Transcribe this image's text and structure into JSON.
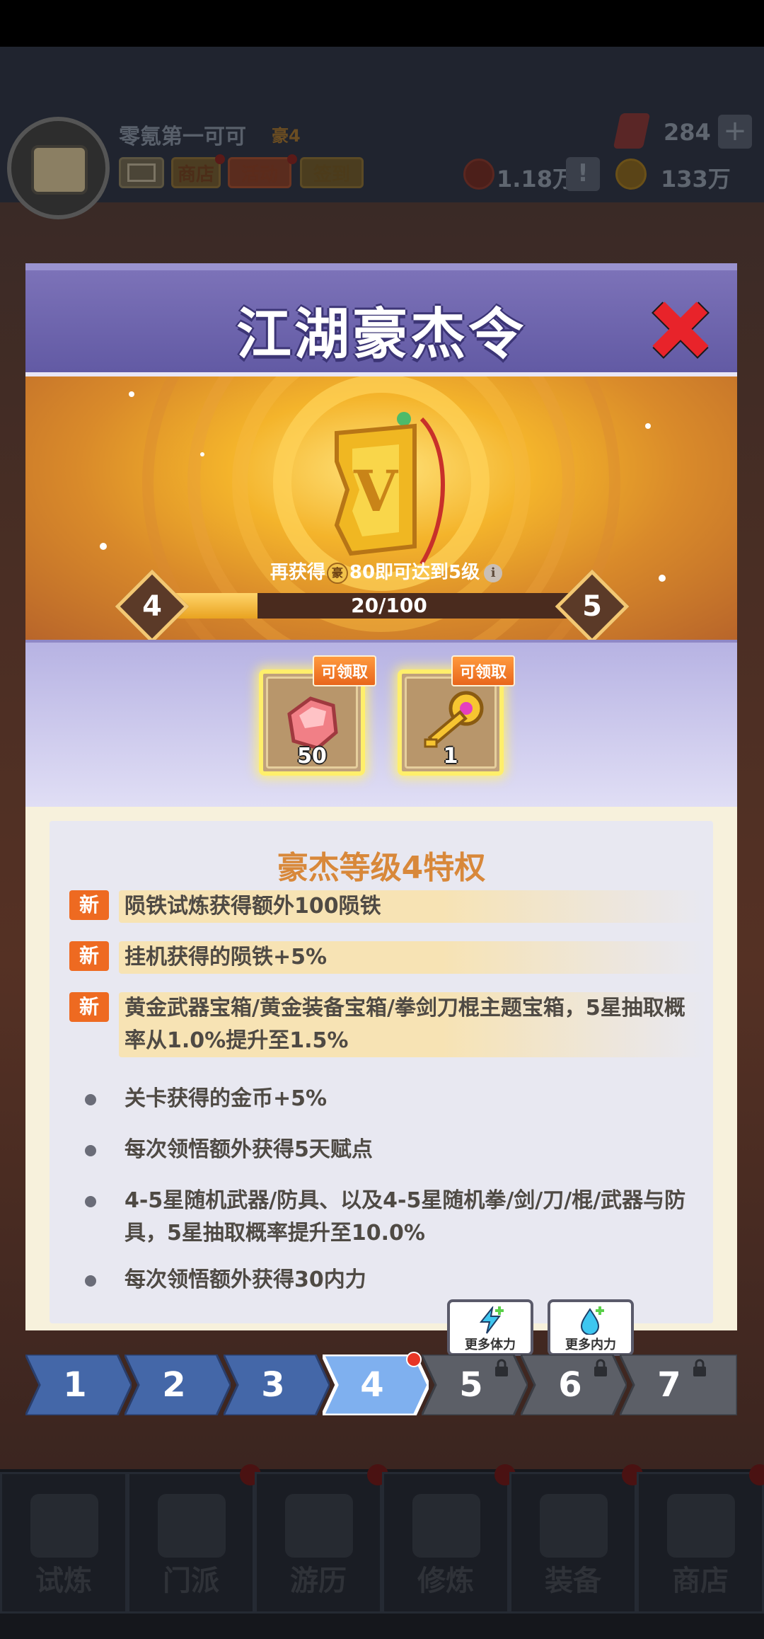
{
  "background": {
    "player_name": "零氪第一可可",
    "player_rank": "豪4",
    "buttons": {
      "shop": "商店",
      "activity": "活动",
      "sign_in": "签到"
    },
    "resources": {
      "gems": "284",
      "power": "1.18万",
      "coins": "133万"
    },
    "nav": [
      {
        "label": "试炼",
        "icon": "ninja-icon"
      },
      {
        "label": "门派",
        "icon": "temple-icon"
      },
      {
        "label": "游历",
        "icon": "mountain-icon"
      },
      {
        "label": "修炼",
        "icon": "scroll-icon"
      },
      {
        "label": "装备",
        "icon": "sword-icon"
      },
      {
        "label": "商店",
        "icon": "house-icon"
      }
    ]
  },
  "modal": {
    "title": "江湖豪杰令",
    "level_message_prefix": "再获得",
    "level_message_badge": "豪",
    "level_message_suffix": "80即可达到5级",
    "current_level": "4",
    "next_level": "5",
    "progress_text": "20/100",
    "progress_fraction": 0.2,
    "rewards": [
      {
        "tag": "可领取",
        "qty": "50",
        "icon": "meteor-iron-icon"
      },
      {
        "tag": "可领取",
        "qty": "1",
        "icon": "golden-key-icon"
      }
    ],
    "privilege_title": "豪杰等级4特权",
    "new_label": "新",
    "privileges": [
      {
        "is_new": true,
        "text": "陨铁试炼获得额外100陨铁"
      },
      {
        "is_new": true,
        "text": "挂机获得的陨铁+5%"
      },
      {
        "is_new": true,
        "text": "黄金武器宝箱/黄金装备宝箱/拳剑刀棍主题宝箱，5星抽取概率从1.0%提升至1.5%"
      },
      {
        "is_new": false,
        "text": "关卡获得的金币+5%"
      },
      {
        "is_new": false,
        "text": "每次领悟额外获得5天赋点"
      },
      {
        "is_new": false,
        "text": "4-5星随机武器/防具、以及4-5星随机拳/剑/刀/棍/武器与防具，5星抽取概率提升至10.0%"
      },
      {
        "is_new": false,
        "text": "每次领悟额外获得30内力"
      }
    ],
    "boosts": [
      {
        "label": "更多体力",
        "icon": "lightning-icon"
      },
      {
        "label": "更多内力",
        "icon": "water-drop-icon"
      }
    ],
    "level_tabs": [
      {
        "label": "1",
        "state": "unlocked"
      },
      {
        "label": "2",
        "state": "unlocked"
      },
      {
        "label": "3",
        "state": "unlocked"
      },
      {
        "label": "4",
        "state": "selected"
      },
      {
        "label": "5",
        "state": "locked"
      },
      {
        "label": "6",
        "state": "locked"
      },
      {
        "label": "7",
        "state": "locked"
      }
    ],
    "colors": {
      "header": "#6d65ad",
      "accent_orange": "#ee6a21",
      "privilege_title": "#d8883a",
      "tab_blue": "#3d5a9a",
      "tab_selected": "#8ab6f0"
    }
  }
}
